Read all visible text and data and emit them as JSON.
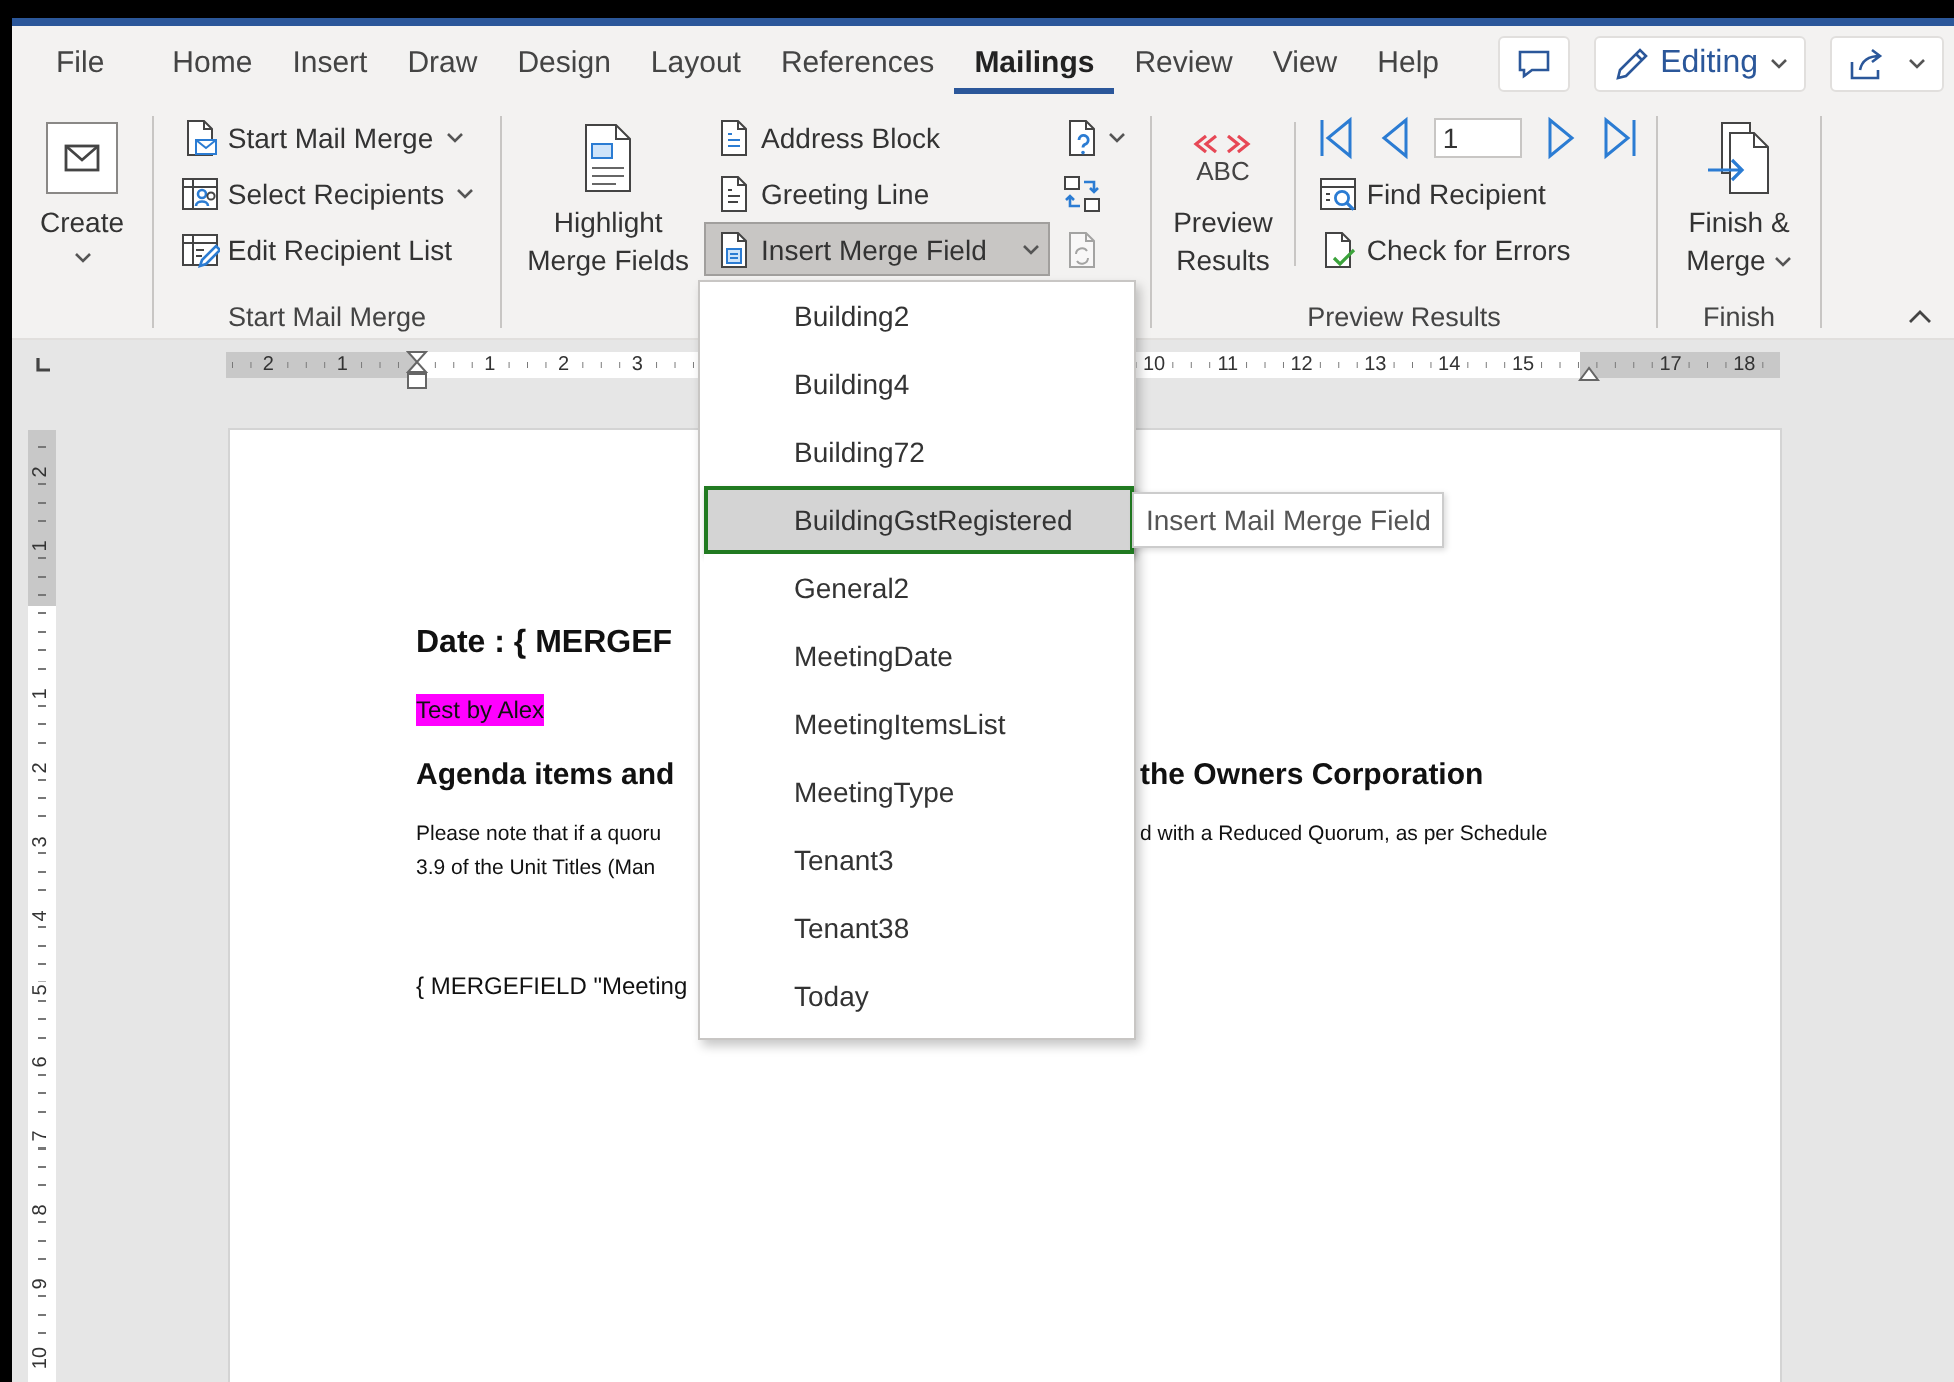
{
  "tabs": [
    {
      "label": "File",
      "selected": false
    },
    {
      "label": "Home",
      "selected": false
    },
    {
      "label": "Insert",
      "selected": false
    },
    {
      "label": "Draw",
      "selected": false
    },
    {
      "label": "Design",
      "selected": false
    },
    {
      "label": "Layout",
      "selected": false
    },
    {
      "label": "References",
      "selected": false
    },
    {
      "label": "Mailings",
      "selected": true
    },
    {
      "label": "Review",
      "selected": false
    },
    {
      "label": "View",
      "selected": false
    },
    {
      "label": "Help",
      "selected": false
    }
  ],
  "mode_button": {
    "label": "Editing"
  },
  "ribbon": {
    "groups": [
      {
        "columns": [
          {
            "kind": "large",
            "lines": [
              "Create"
            ],
            "dropdown": true
          }
        ]
      },
      {
        "label": "Start Mail Merge",
        "columns": [
          {
            "kind": "stack",
            "items": [
              {
                "label": "Start Mail Merge",
                "dropdown": true,
                "pressed": false
              },
              {
                "label": "Select Recipients",
                "dropdown": true,
                "pressed": false
              },
              {
                "label": "Edit Recipient List",
                "dropdown": false,
                "pressed": false
              }
            ]
          }
        ]
      },
      {
        "columns": [
          {
            "kind": "large",
            "lines": [
              "Highlight",
              "Merge Fields"
            ],
            "dropdown": false
          },
          {
            "kind": "stack",
            "items": [
              {
                "label": "Address Block",
                "dropdown": false,
                "pressed": false
              },
              {
                "label": "Greeting Line",
                "dropdown": false,
                "pressed": false
              },
              {
                "label": "Insert Merge Field",
                "dropdown": true,
                "pressed": true
              }
            ]
          },
          {
            "kind": "icons",
            "items": [
              {
                "dropdown": true,
                "disabled": false
              },
              {
                "dropdown": false,
                "disabled": false
              },
              {
                "dropdown": false,
                "disabled": true
              }
            ]
          }
        ]
      },
      {
        "label": "Preview Results",
        "columns": [
          {
            "kind": "large",
            "badge": "ABC",
            "lines": [
              "Preview",
              "Results"
            ],
            "dropdown": false
          },
          {
            "kind": "divider"
          },
          {
            "kind": "nav",
            "record": "1",
            "items": [
              {
                "label": "Find Recipient"
              },
              {
                "label": "Check for Errors"
              }
            ]
          }
        ]
      },
      {
        "label": "Finish",
        "columns": [
          {
            "kind": "large",
            "lines": [
              "Finish &",
              "Merge"
            ],
            "dropdown": true
          }
        ]
      }
    ]
  },
  "horizontal_ruler": {
    "left_margin_labels": [
      "2",
      "1"
    ],
    "labels_before_menu": [
      "1",
      "2",
      "3"
    ],
    "labels_after_menu": [
      "10",
      "11",
      "12",
      "13",
      "14",
      "15"
    ],
    "right_margin_labels": [
      "17",
      "18"
    ]
  },
  "vertical_ruler": {
    "top_margin_labels": [
      "2",
      "1"
    ],
    "labels": [
      "1",
      "2",
      "3",
      "4",
      "5",
      "6",
      "7",
      "8",
      "9",
      "10"
    ]
  },
  "document": {
    "blocks": [
      {
        "kind": "heading",
        "lines": [
          {
            "left": "Date : { MERGEF"
          }
        ]
      },
      {
        "kind": "highlight",
        "lines": [
          {
            "left": "Test by Alex"
          }
        ]
      },
      {
        "kind": "subheading",
        "lines": [
          {
            "left": "Agenda items and",
            "right": "the Owners Corporation"
          }
        ]
      },
      {
        "kind": "paragraph",
        "lines": [
          {
            "left": "Please note that if a quoru",
            "right": "d with a Reduced Quorum, as per Schedule"
          },
          {
            "left": "3.9 of the Unit Titles (Man"
          }
        ]
      },
      {
        "kind": "field",
        "lines": [
          {
            "left": "{ MERGEFIELD \"Meeting"
          }
        ]
      }
    ]
  },
  "merge_field_menu": {
    "items": [
      {
        "label": "Building2",
        "selected": false
      },
      {
        "label": "Building4",
        "selected": false
      },
      {
        "label": "Building72",
        "selected": false
      },
      {
        "label": "BuildingGstRegistered",
        "selected": true
      },
      {
        "label": "General2",
        "selected": false
      },
      {
        "label": "MeetingDate",
        "selected": false
      },
      {
        "label": "MeetingItemsList",
        "selected": false
      },
      {
        "label": "MeetingType",
        "selected": false
      },
      {
        "label": "Tenant3",
        "selected": false
      },
      {
        "label": "Tenant38",
        "selected": false
      },
      {
        "label": "Today",
        "selected": false
      }
    ]
  },
  "tooltip": {
    "text": "Insert Mail Merge Field"
  }
}
